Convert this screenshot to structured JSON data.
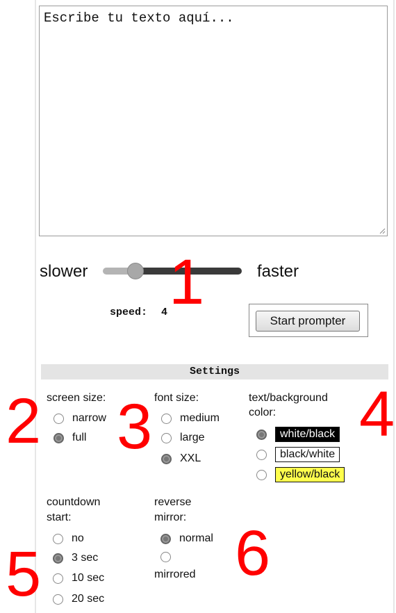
{
  "editor": {
    "text": "Escribe tu texto aquí..."
  },
  "speed": {
    "slower_label": "slower",
    "faster_label": "faster",
    "label": "speed:",
    "value": "4",
    "level": 4
  },
  "start_button_label": "Start prompter",
  "settings": {
    "title": "Settings",
    "screen_size": {
      "title_line1": "screen size:",
      "options": [
        "narrow",
        "full"
      ],
      "selected": "full"
    },
    "font_size": {
      "title_line1": "font size:",
      "options": [
        "medium",
        "large",
        "XXL"
      ],
      "selected": "XXL"
    },
    "color": {
      "title_line1": "text/background",
      "title_line2": "color:",
      "options": [
        "white/black",
        "black/white",
        "yellow/black"
      ],
      "selected": "white/black"
    },
    "countdown": {
      "title_line1": "countdown",
      "title_line2": "start:",
      "options": [
        "no",
        "3 sec",
        "10 sec",
        "20 sec"
      ],
      "selected": "3 sec"
    },
    "mirror": {
      "title_line1": "reverse",
      "title_line2": "mirror:",
      "options": [
        "normal",
        "mirrored"
      ],
      "selected": "normal"
    }
  },
  "annotations": [
    "1",
    "2",
    "3",
    "4",
    "5",
    "6"
  ],
  "colors": {
    "annotation": "#ff0000",
    "chip_yellow": "#ffff4d"
  }
}
